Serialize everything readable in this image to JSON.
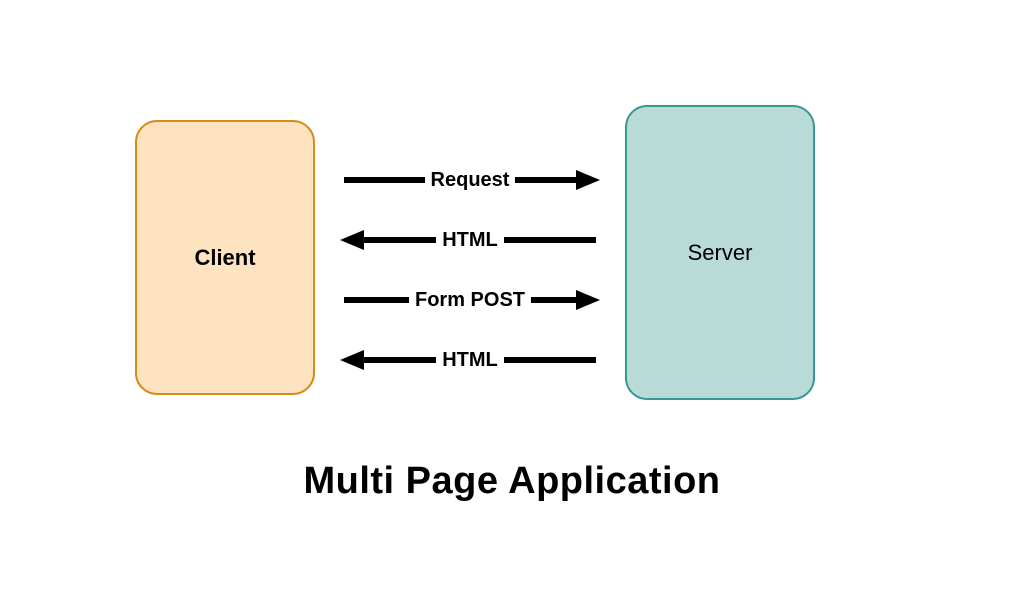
{
  "title": "Multi Page Application",
  "nodes": {
    "client": {
      "label": "Client"
    },
    "server": {
      "label": "Server"
    }
  },
  "arrows": [
    {
      "label": "Request",
      "direction": "right"
    },
    {
      "label": "HTML",
      "direction": "left"
    },
    {
      "label": "Form POST",
      "direction": "right"
    },
    {
      "label": "HTML",
      "direction": "left"
    }
  ],
  "colors": {
    "clientFill": "#fde3bf",
    "clientStroke": "#d68a1a",
    "serverFill": "#b9dbd8",
    "serverStroke": "#3a9690",
    "arrow": "#000000"
  }
}
